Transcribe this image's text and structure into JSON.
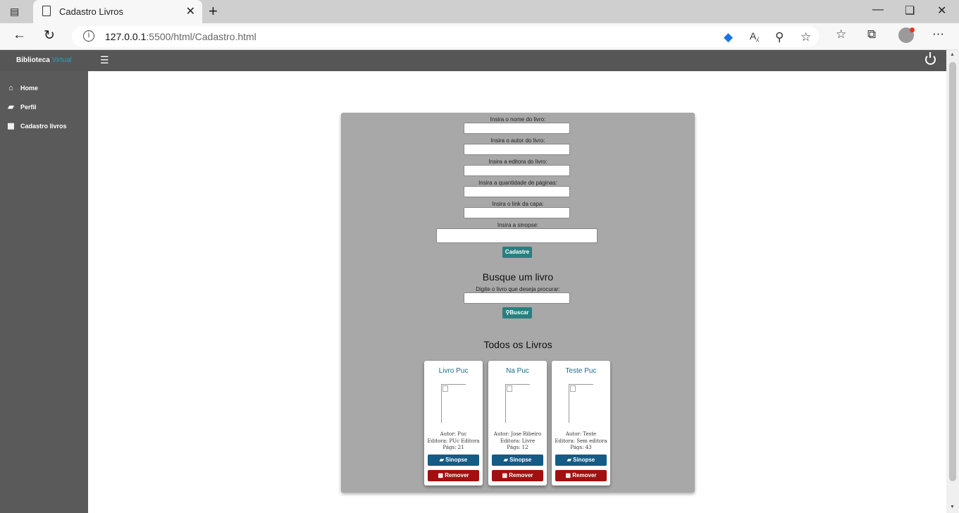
{
  "browser": {
    "tab_title": "Cadastro Livros",
    "url_host": "127.0.0.1",
    "url_path": ":5500/html/Cadastro.html"
  },
  "app": {
    "brand_main": "Biblioteca",
    "brand_accent": "Virtual",
    "accent_color": "#2aa3b8"
  },
  "sidebar": {
    "items": [
      {
        "label": "Home",
        "icon": "home-icon"
      },
      {
        "label": "Perfil",
        "icon": "book-icon"
      },
      {
        "label": "Cadastro livros",
        "icon": "table-icon"
      }
    ]
  },
  "form": {
    "name_label": "Insira o nome do livro:",
    "author_label": "Insira o autor do livro:",
    "publisher_label": "Insira a editora do livro:",
    "pages_label": "Insira a quantidade de páginas:",
    "cover_label": "Insira o link da capa:",
    "synopsis_label": "Insira a sinopse:",
    "submit_label": "Cadastre"
  },
  "search": {
    "heading": "Busque um livro",
    "label": "Digite o livro que deseja procurar:",
    "button_label": "Buscar"
  },
  "books": {
    "heading": "Todos os Livros",
    "synopsis_label": "Sinopse",
    "remove_label": "Remover",
    "items": [
      {
        "title": "Livro Puc",
        "author": "Autor: Puc",
        "publisher": "Editora: PUc Editora",
        "pages": "Págs: 21"
      },
      {
        "title": "Na Puc",
        "author": "Autor: Jose Ribeiro",
        "publisher": "Editora: Livre",
        "pages": "Págs: 12"
      },
      {
        "title": "Teste Puc",
        "author": "Autor: Teste",
        "publisher": "Editora: Sem editora",
        "pages": "Págs: 43"
      }
    ]
  }
}
